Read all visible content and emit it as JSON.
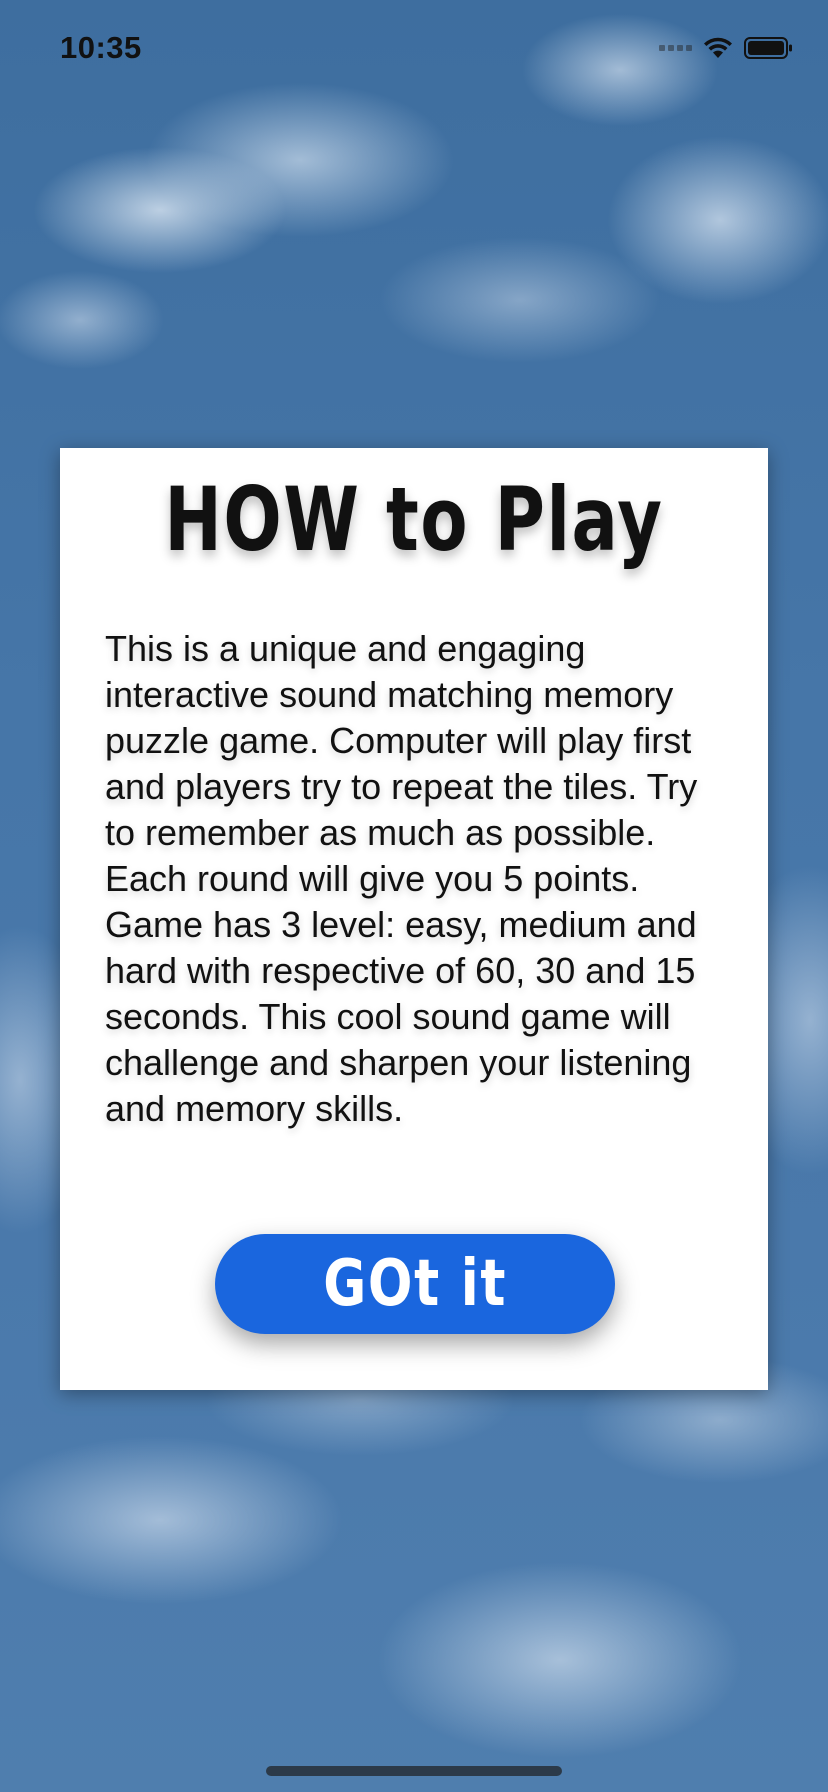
{
  "status_bar": {
    "time": "10:35"
  },
  "dialog": {
    "title": "HOW to Play",
    "body": "This is a unique and engaging interactive sound matching memory puzzle game. Computer will play first and players try to repeat the tiles. Try to remember as much as possible. Each round will give you 5 points. Game has 3 level: easy, medium and hard with respective of 60, 30 and 15 seconds. This cool sound game will challenge and sharpen your listening and memory skills.",
    "button_label": "GOt it"
  },
  "colors": {
    "button": "#1a66de",
    "card": "#ffffff",
    "sky": "#4676a8"
  },
  "icons": [
    "signal-icon",
    "wifi-icon",
    "battery-icon"
  ]
}
